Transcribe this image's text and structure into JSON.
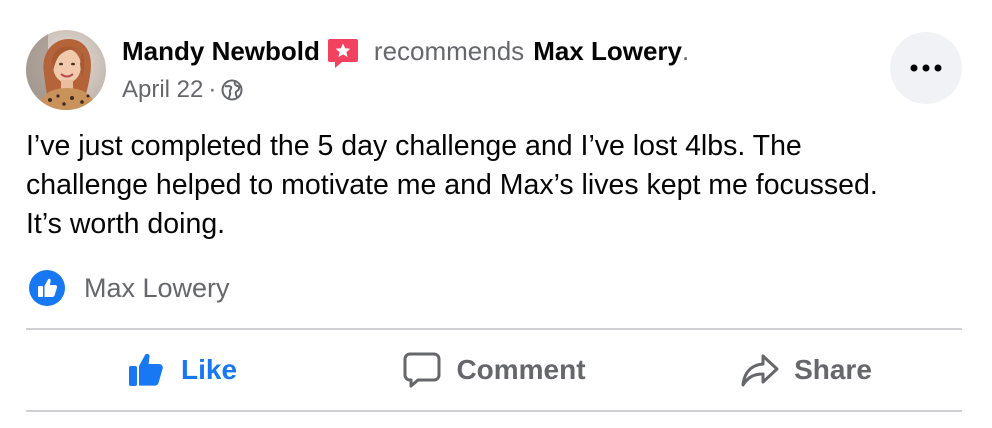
{
  "post": {
    "author_name": "Mandy Newbold",
    "verb": "recommends",
    "page_name": "Max Lowery",
    "trailing_punct": ".",
    "date": "April 22",
    "separator": "·",
    "audience_icon": "globe-icon",
    "recommendation_badge_icon": "recommendation-star-icon",
    "text_lines": [
      "I’ve just completed the 5 day challenge and I’ve lost 4lbs. The",
      "challenge helped to motivate me and Max’s lives kept me focussed.",
      "It’s worth doing."
    ]
  },
  "reactions": {
    "icon": "like-bubble-icon",
    "names": "Max Lowery"
  },
  "actions": {
    "like_label": "Like",
    "comment_label": "Comment",
    "share_label": "Share"
  },
  "colors": {
    "facebook_blue": "#1877f2",
    "secondary_text": "#65676b",
    "recommend_badge": "#f3425f",
    "divider": "#ced0d4",
    "more_button_bg": "#f0f2f5"
  }
}
